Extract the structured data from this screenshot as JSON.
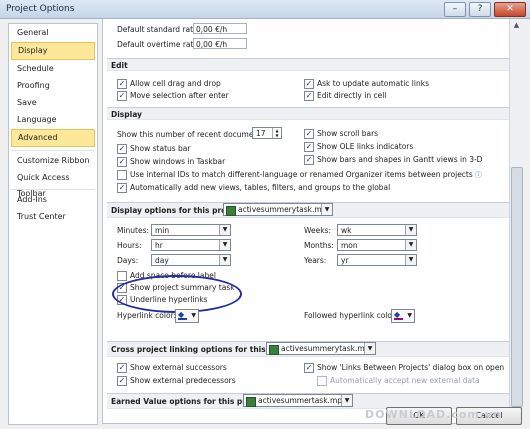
{
  "window": {
    "title": "Project Options",
    "minimize": "–",
    "help": "?",
    "close": "✕"
  },
  "nav": [
    {
      "label": "General"
    },
    {
      "label": "Display"
    },
    {
      "label": "Schedule"
    },
    {
      "label": "Proofing"
    },
    {
      "label": "Save"
    },
    {
      "label": "Language"
    },
    {
      "label": "Advanced"
    },
    {
      "label": "Customize Ribbon"
    },
    {
      "label": "Quick Access Toolbar"
    },
    {
      "label": "Add-Ins"
    },
    {
      "label": "Trust Center"
    }
  ],
  "rates": {
    "standard_label": "Default standard rate:",
    "standard_value": "0,00 €/h",
    "overtime_label": "Default overtime rate:",
    "overtime_value": "0,00 €/h"
  },
  "edit": {
    "header": "Edit",
    "drag_drop": "Allow cell drag and drop",
    "ask_update": "Ask to update automatic links",
    "move_selection": "Move selection after enter",
    "edit_in_cell": "Edit directly in cell"
  },
  "display": {
    "header": "Display",
    "recent_docs_label": "Show this number of recent documents:",
    "recent_docs_value": "17",
    "status_bar": "Show status bar",
    "windows_taskbar": "Show windows in Taskbar",
    "internal_ids": "Use internal IDs to match different-language or renamed Organizer items between projects",
    "auto_add_views": "Automatically add new views, tables, filters, and groups to the global",
    "scroll_bars": "Show scroll bars",
    "ole_links": "Show OLE links indicators",
    "bars_shapes": "Show bars and shapes in Gantt views in 3-D"
  },
  "display_project": {
    "header": "Display options for this project:",
    "project_name": "activesummerytask.mpp",
    "minutes_label": "Minutes:",
    "minutes_value": "min",
    "hours_label": "Hours:",
    "hours_value": "hr",
    "days_label": "Days:",
    "days_value": "day",
    "weeks_label": "Weeks:",
    "weeks_value": "wk",
    "months_label": "Months:",
    "months_value": "mon",
    "years_label": "Years:",
    "years_value": "yr",
    "add_space": "Add space before label",
    "show_summary": "Show project summary task",
    "underline_links": "Underline hyperlinks",
    "hyperlink_color": "Hyperlink color:",
    "followed_color": "Followed hyperlink color:"
  },
  "cross_project": {
    "header": "Cross project linking options for this project:",
    "project_name": "activesummerytask.mpp",
    "ext_successors": "Show external successors",
    "ext_predecessors": "Show external predecessors",
    "links_dialog": "Show 'Links Between Projects' dialog box on open",
    "auto_accept": "Automatically accept new external data"
  },
  "earned_value": {
    "header": "Earned Value options for this project:",
    "project_name": "activesummertask.mpp"
  },
  "buttons": {
    "ok": "OK",
    "cancel": "Cancel"
  },
  "watermark": "DOWNLOAD.com.vn",
  "colors": {
    "accent": "#fde89a",
    "hyperlink": "#1c3ea6",
    "followed": "#8c0c84",
    "annotation": "#232c9e"
  }
}
